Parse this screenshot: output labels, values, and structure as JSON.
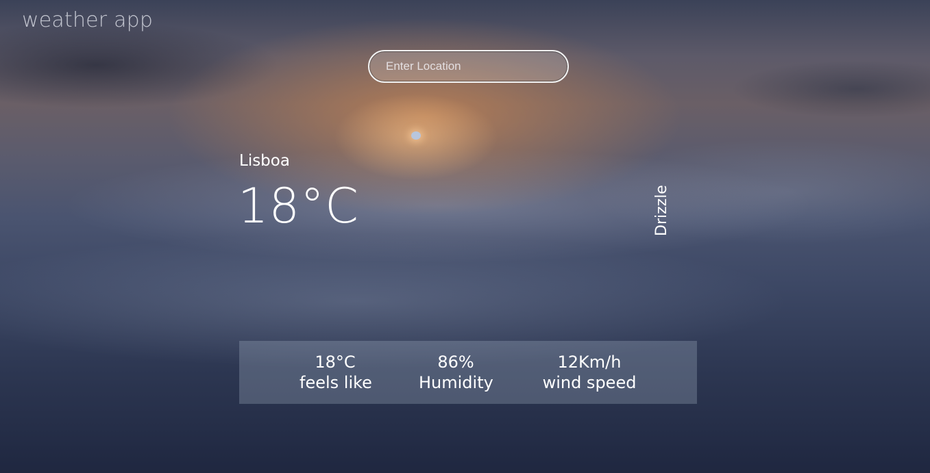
{
  "app": {
    "title": "weather app"
  },
  "search": {
    "placeholder": "Enter Location",
    "value": ""
  },
  "weather": {
    "city": "Lisboa",
    "temperature": "18°C",
    "condition": "Drizzle"
  },
  "stats": {
    "feels_like": {
      "value": "18°C",
      "label": "feels like"
    },
    "humidity": {
      "value": "86%",
      "label": "Humidity"
    },
    "wind_speed": {
      "value": "12Km/h",
      "label": "wind speed"
    }
  },
  "colors": {
    "text": "#ffffff",
    "panel": "#afbed2",
    "sky_top": "#3b4258",
    "sky_glow": "#cd8750",
    "sky_bottom": "#1f2740"
  }
}
